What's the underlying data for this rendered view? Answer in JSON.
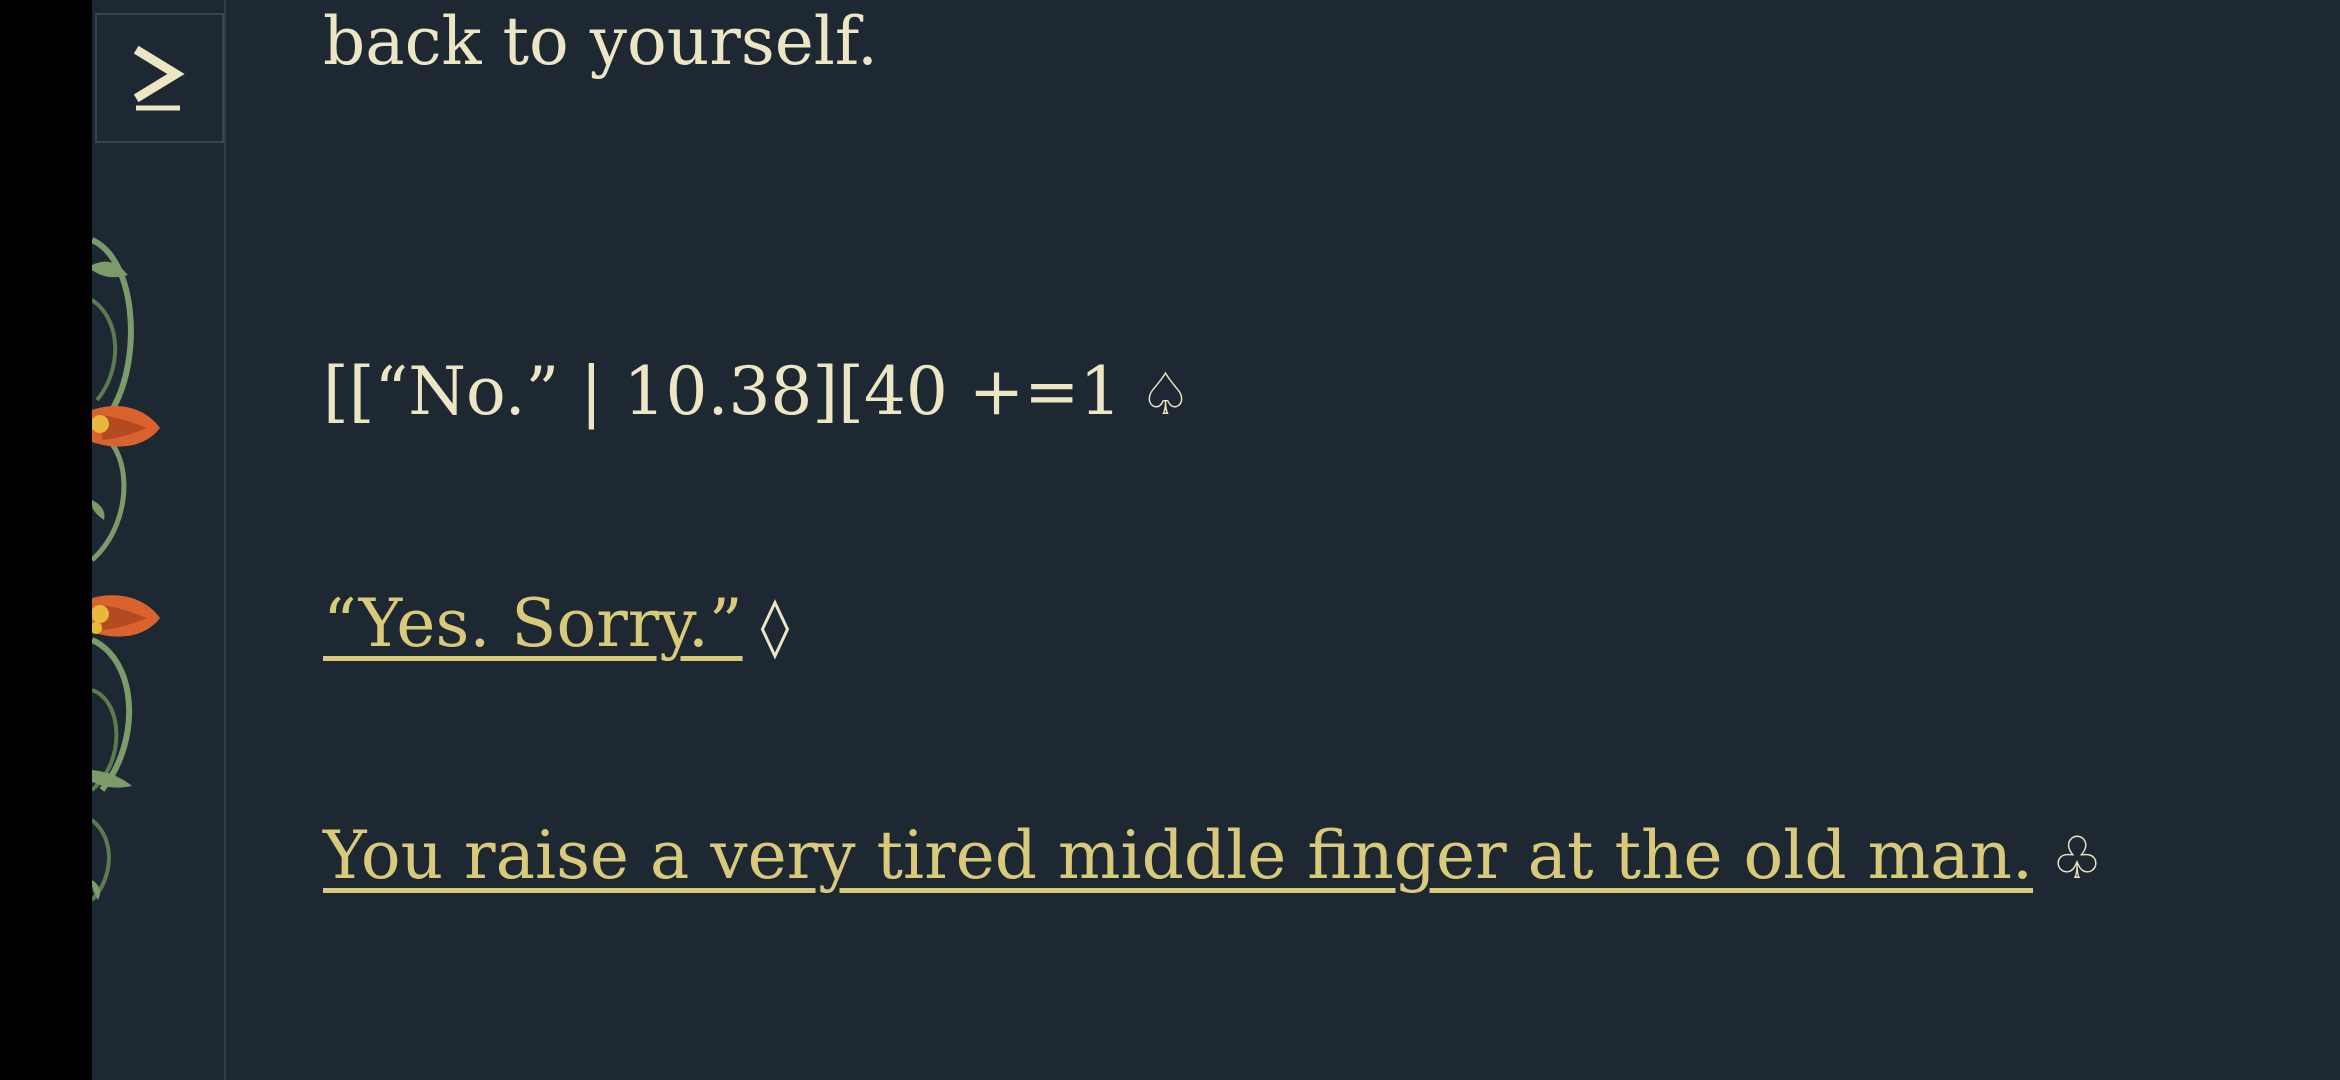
{
  "story": {
    "passage_tail": "back to yourself.",
    "raw_markup": "[[“No.” | 10.38][40 +=1",
    "raw_symbol": "♤",
    "choices": [
      {
        "label": "“Yes. Sorry.”",
        "symbol": "◊"
      },
      {
        "label": "You raise a very tired middle finger at the old man.",
        "symbol": "♧"
      }
    ]
  },
  "sidebar": {
    "toggle_icon": "chevron-right-icon"
  },
  "colors": {
    "background": "#1d2832",
    "text": "#ede6c4",
    "link": "#d9c97a",
    "ornament_leaf": "#7d9a6a",
    "ornament_flower": "#d9622f",
    "ornament_center": "#e6b83c"
  }
}
